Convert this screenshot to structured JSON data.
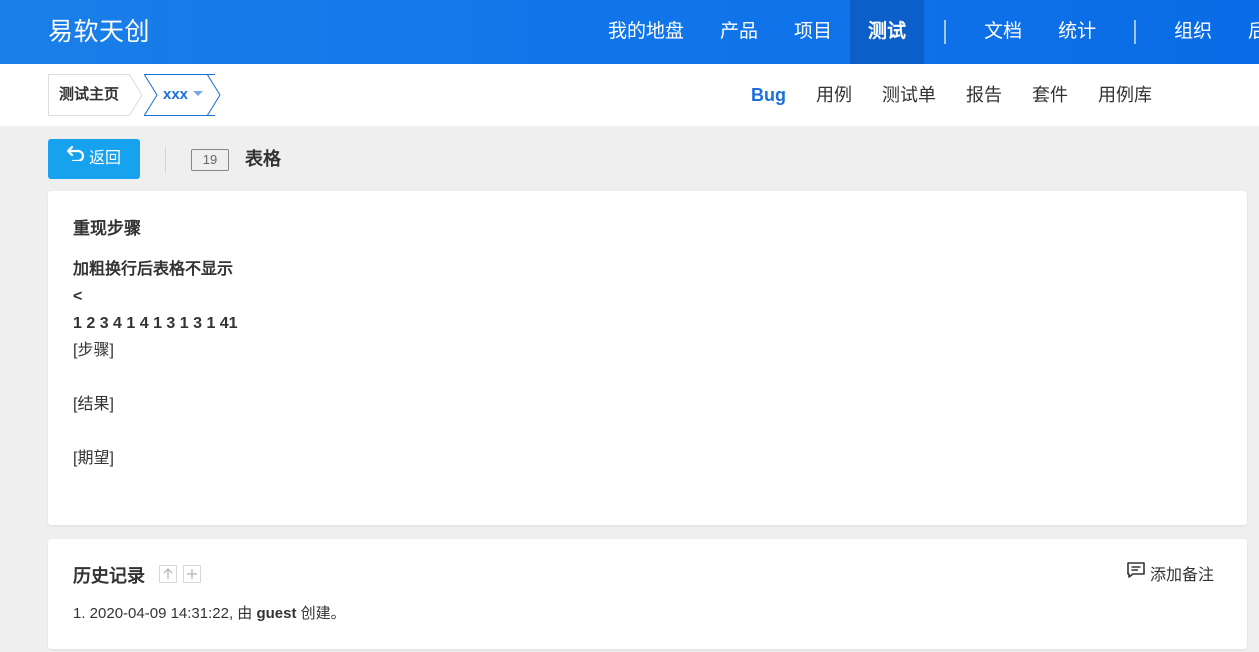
{
  "brand": "易软天创",
  "main_nav": [
    {
      "label": "我的地盘"
    },
    {
      "label": "产品"
    },
    {
      "label": "项目"
    },
    {
      "label": "测试",
      "active": true
    },
    {
      "label": "文档"
    },
    {
      "label": "统计"
    },
    {
      "label": "组织"
    },
    {
      "label": "后"
    }
  ],
  "breadcrumb": {
    "home": "测试主页",
    "product": "xxx"
  },
  "sub_nav": [
    {
      "label": "Bug",
      "active": true
    },
    {
      "label": "用例"
    },
    {
      "label": "测试单"
    },
    {
      "label": "报告"
    },
    {
      "label": "套件"
    },
    {
      "label": "用例库"
    }
  ],
  "actions": {
    "back_label": "返回"
  },
  "bug": {
    "id": "19",
    "title": "表格"
  },
  "steps": {
    "title": "重现步骤",
    "line1": "加粗换行后表格不显示",
    "line2": "<",
    "line3": "1 2 3 4 1 4 1 3 1 3 1 41",
    "step_label": "[步骤]",
    "result_label": "[结果]",
    "expect_label": "[期望]"
  },
  "history": {
    "title": "历史记录",
    "add_note": "添加备注",
    "entry_prefix": "1. 2020-04-09 14:31:22, 由 ",
    "entry_user": "guest",
    "entry_suffix": " 创建。"
  },
  "colors": {
    "topbar": "#1175ea",
    "active_nav": "#0c5fc8",
    "accent": "#1a6fd8",
    "back_button": "#17a2f0",
    "page_bg": "#efefef"
  }
}
